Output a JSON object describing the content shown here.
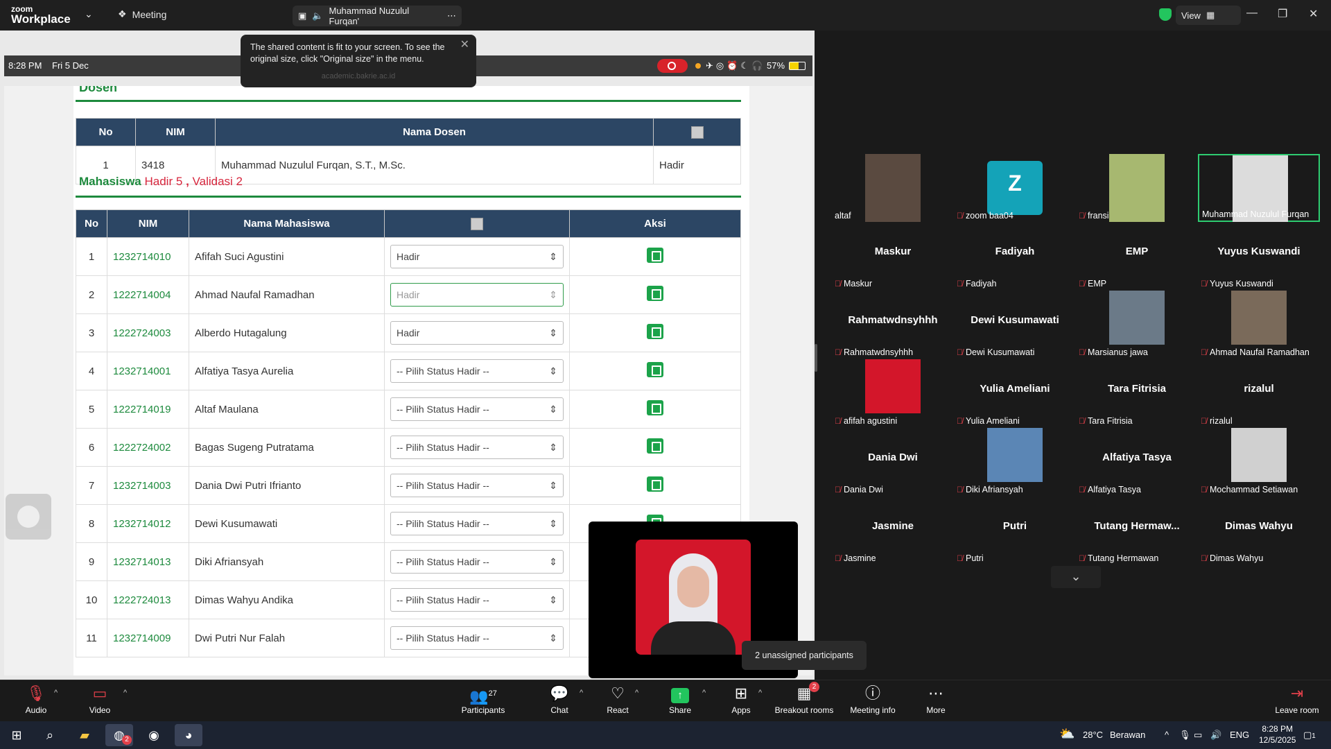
{
  "zoom_header": {
    "logo_small": "zoom",
    "logo_big": "Workplace",
    "meeting_label": "Meeting",
    "speaker_name": "Muhammad Nuzulul Furqan'",
    "view_label": "View"
  },
  "toast": {
    "message": "The shared content is fit to your screen. To see the original size, click \"Original size\" in the menu.",
    "url": "academic.bakrie.ac.id"
  },
  "device_status": {
    "time": "8:28 PM",
    "date": "Fri 5 Dec",
    "battery": "57%"
  },
  "page": {
    "dosen_title": "Dosen",
    "dosen_table": {
      "headers": [
        "No",
        "NIM",
        "Nama Dosen",
        ""
      ],
      "rows": [
        [
          "1",
          "3418",
          "Muhammad Nuzulul Furqan, S.T., M.Sc.",
          "Hadir"
        ]
      ]
    },
    "mahasiswa_title": "Mahasiswa",
    "hadir_label": "Hadir",
    "hadir_count": "5",
    "sep": ",",
    "validasi_label": "Validasi",
    "validasi_count": "2",
    "mhs_table": {
      "headers": [
        "No",
        "NIM",
        "Nama Mahasiswa",
        "",
        "Aksi"
      ],
      "rows": [
        {
          "no": "1",
          "nim": "1232714010",
          "nama": "Afifah Suci Agustini",
          "status": "Hadir",
          "focus": false
        },
        {
          "no": "2",
          "nim": "1222714004",
          "nama": "Ahmad Naufal Ramadhan",
          "status": "Hadir",
          "focus": true
        },
        {
          "no": "3",
          "nim": "1222724003",
          "nama": "Alberdo Hutagalung",
          "status": "Hadir",
          "focus": false
        },
        {
          "no": "4",
          "nim": "1232714001",
          "nama": "Alfatiya Tasya Aurelia",
          "status": "-- Pilih Status Hadir --",
          "focus": false
        },
        {
          "no": "5",
          "nim": "1222714019",
          "nama": "Altaf Maulana",
          "status": "-- Pilih Status Hadir --",
          "focus": false
        },
        {
          "no": "6",
          "nim": "1222724002",
          "nama": "Bagas Sugeng Putratama",
          "status": "-- Pilih Status Hadir --",
          "focus": false
        },
        {
          "no": "7",
          "nim": "1232714003",
          "nama": "Dania Dwi Putri Ifrianto",
          "status": "-- Pilih Status Hadir --",
          "focus": false
        },
        {
          "no": "8",
          "nim": "1232714012",
          "nama": "Dewi Kusumawati",
          "status": "-- Pilih Status Hadir --",
          "focus": false
        },
        {
          "no": "9",
          "nim": "1232714013",
          "nama": "Diki Afriansyah",
          "status": "-- Pilih Status Hadir --",
          "focus": false
        },
        {
          "no": "10",
          "nim": "1222724013",
          "nama": "Dimas Wahyu Andika",
          "status": "-- Pilih Status Hadir --",
          "focus": false
        },
        {
          "no": "11",
          "nim": "1232714009",
          "nama": "Dwi Putri Nur Falah",
          "status": "-- Pilih Status Hadir --",
          "focus": false
        }
      ]
    }
  },
  "gallery": [
    {
      "big": "",
      "label": "altaf",
      "muted": false,
      "photo": "#5a4a40",
      "active": false
    },
    {
      "big": "Z",
      "label": "zoom baa04",
      "muted": true,
      "photo": "#14a3b8",
      "active": false
    },
    {
      "big": "",
      "label": "fransi",
      "muted": true,
      "photo": "#a7b870",
      "active": false
    },
    {
      "big": "",
      "label": "Muhammad Nuzulul Furqan",
      "muted": false,
      "photo": "#dcdcdc",
      "active": true
    },
    {
      "big": "Maskur",
      "label": "Maskur",
      "muted": true,
      "photo": "",
      "active": false
    },
    {
      "big": "Fadiyah",
      "label": "Fadiyah",
      "muted": true,
      "photo": "",
      "active": false
    },
    {
      "big": "EMP",
      "label": "EMP",
      "muted": true,
      "photo": "",
      "active": false
    },
    {
      "big": "Yuyus Kuswandi",
      "label": "Yuyus Kuswandi",
      "muted": true,
      "photo": "",
      "active": false
    },
    {
      "big": "Rahmatwdnsyhhh",
      "label": "Rahmatwdnsyhhh",
      "muted": true,
      "photo": "",
      "active": false
    },
    {
      "big": "Dewi Kusumawati",
      "label": "Dewi Kusumawati",
      "muted": true,
      "photo": "",
      "active": false
    },
    {
      "big": "",
      "label": "Marsianus jawa",
      "muted": true,
      "photo": "#6b7a88",
      "active": false
    },
    {
      "big": "",
      "label": "Ahmad Naufal Ramadhan",
      "muted": true,
      "photo": "#7a6a5a",
      "active": false
    },
    {
      "big": "",
      "label": "afifah agustini",
      "muted": true,
      "photo": "#d3162a",
      "active": false
    },
    {
      "big": "Yulia Ameliani",
      "label": "Yulia Ameliani",
      "muted": true,
      "photo": "",
      "active": false
    },
    {
      "big": "Tara Fitrisia",
      "label": "Tara Fitrisia",
      "muted": true,
      "photo": "",
      "active": false
    },
    {
      "big": "rizalul",
      "label": "rizalul",
      "muted": true,
      "photo": "",
      "active": false
    },
    {
      "big": "Dania Dwi",
      "label": "Dania Dwi",
      "muted": true,
      "photo": "",
      "active": false
    },
    {
      "big": "",
      "label": "Diki Afriansyah",
      "muted": true,
      "photo": "#5b86b5",
      "active": false
    },
    {
      "big": "Alfatiya Tasya",
      "label": "Alfatiya Tasya",
      "muted": true,
      "photo": "",
      "active": false
    },
    {
      "big": "",
      "label": "Mochammad Setiawan",
      "muted": true,
      "photo": "#d0d0d0",
      "active": false
    },
    {
      "big": "Jasmine",
      "label": "Jasmine",
      "muted": true,
      "photo": "",
      "active": false
    },
    {
      "big": "Putri",
      "label": "Putri",
      "muted": true,
      "photo": "",
      "active": false
    },
    {
      "big": "Tutang  Hermaw...",
      "label": "Tutang Hermawan",
      "muted": true,
      "photo": "",
      "active": false
    },
    {
      "big": "Dimas Wahyu",
      "label": "Dimas Wahyu",
      "muted": true,
      "photo": "",
      "active": false
    }
  ],
  "unassigned": "2 unassigned participants",
  "toolbar": {
    "audio": "Audio",
    "video": "Video",
    "participants": "Participants",
    "participants_count": "27",
    "chat": "Chat",
    "react": "React",
    "share": "Share",
    "apps": "Apps",
    "breakout": "Breakout rooms",
    "breakout_badge": "2",
    "meeting_info": "Meeting info",
    "more": "More",
    "leave": "Leave room"
  },
  "taskbar": {
    "weather_temp": "28°C",
    "weather_text": "Berawan",
    "lang": "ENG",
    "time": "8:28 PM",
    "date": "12/5/2025",
    "notif": "1",
    "teams_badge": "2"
  },
  "colors": {
    "accent_green": "#1d8a3d",
    "header_navy": "#2c4664",
    "muted_red": "#e2404a",
    "share_green": "#22c55e"
  }
}
